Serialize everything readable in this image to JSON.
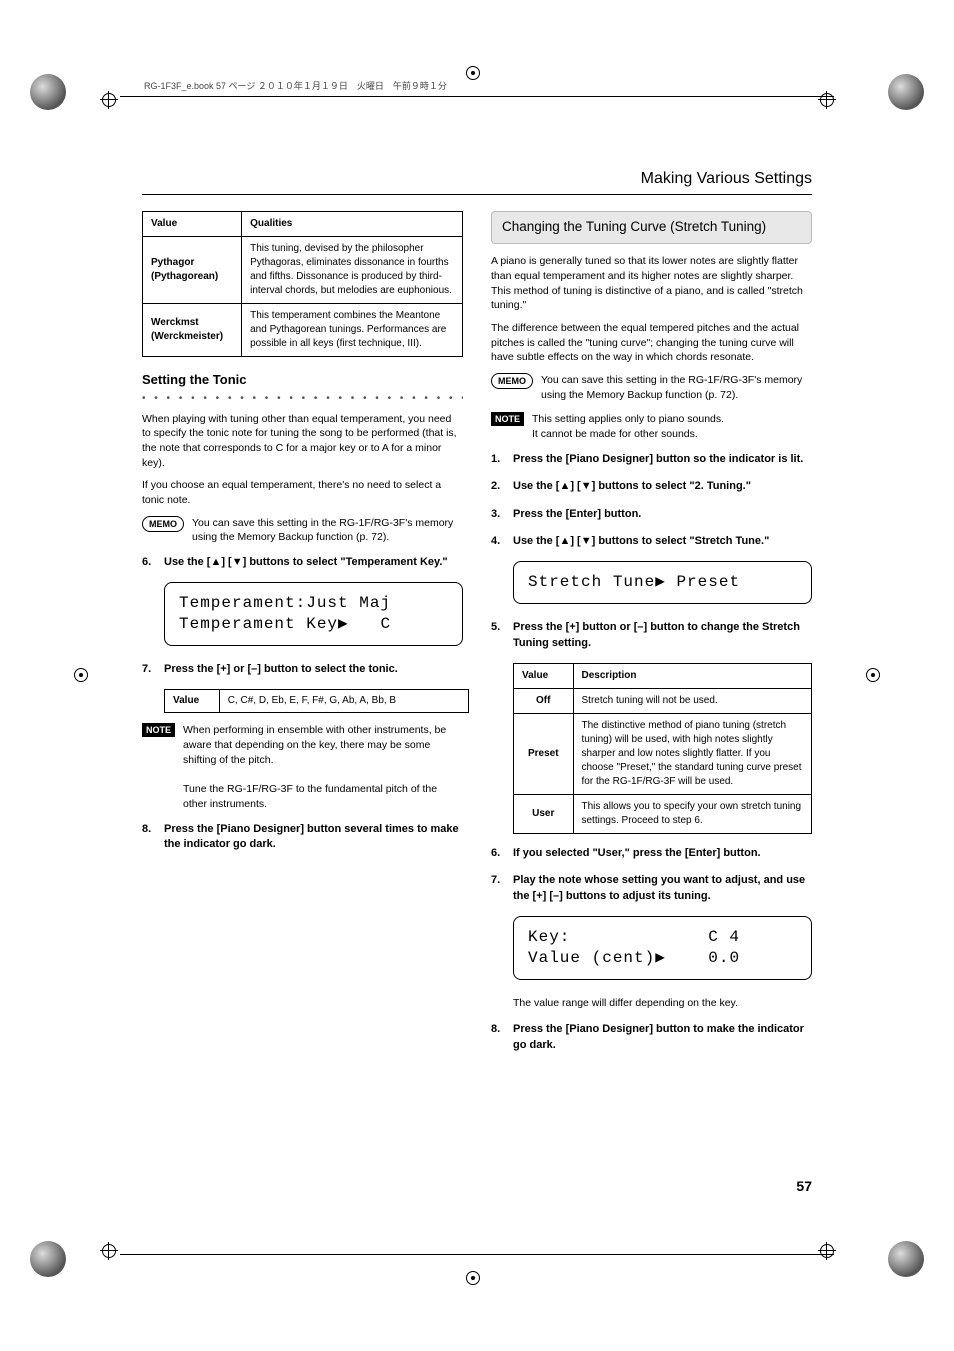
{
  "printHeader": "RG-1F3F_e.book  57 ページ  ２０１０年１月１９日　火曜日　午前９時１分",
  "headerTitle": "Making Various Settings",
  "tuningTable": {
    "headers": [
      "Value",
      "Qualities"
    ],
    "rows": [
      {
        "value": "Pythagor (Pythagorean)",
        "qual": "This tuning, devised by the philosopher Pythagoras, eliminates dissonance in fourths and fifths. Dissonance is produced by third-interval chords, but melodies are euphonious."
      },
      {
        "value": "Werckmst (Werckmeister)",
        "qual": "This temperament combines the Meantone and Pythagorean tunings. Performances are possible in all keys (first technique, III)."
      }
    ]
  },
  "settingTonic": {
    "heading": "Setting the Tonic",
    "dots": "• • • • • • • • • • • • • • • • • • • • • • • • • • • • • • • • • • • • • • •",
    "p1": "When playing with tuning other than equal temperament, you need to specify the tonic note for tuning the song to be performed (that is, the note that corresponds to C for a major key or to A for a minor key).",
    "p2": "If you choose an equal temperament, there's no need to select a tonic note.",
    "memo": "You can save this setting in the RG-1F/RG-3F's memory using the Memory Backup function (p. 72).",
    "step6": "Use the [▲] [▼] buttons to select \"Temperament Key.\"",
    "lcd1a": "Temperament:Just Maj",
    "lcd1b": "Temperament Key▶   C",
    "step7": "Press the [+] or [–] button to select the tonic.",
    "valueLabel": "Value",
    "valueList": "C, C#, D, Eb, E, F, F#, G, Ab, A, Bb, B",
    "note1": "When performing in ensemble with other instruments, be aware that depending on the key, there may be some shifting of the pitch.",
    "note2": "Tune the RG-1F/RG-3F to the fundamental pitch of the other instruments.",
    "step8": "Press the [Piano Designer] button several times to make the indicator go dark."
  },
  "stretch": {
    "section": "Changing the Tuning Curve (Stretch Tuning)",
    "p1": "A piano is generally tuned so that its lower notes are slightly flatter than equal temperament and its higher notes are slightly sharper. This method of tuning is distinctive of a piano, and is called \"stretch tuning.\"",
    "p2": "The difference between the equal tempered pitches and the actual pitches is called the \"tuning curve\"; changing the tuning curve will have subtle effects on the way in which chords resonate.",
    "memo": "You can save this setting in the RG-1F/RG-3F's memory using the Memory Backup function (p. 72).",
    "noteA": "This setting applies only to piano sounds.",
    "noteB": "It cannot be made for other sounds.",
    "step1": "Press the [Piano Designer] button so the indicator is lit.",
    "step2": "Use the [▲] [▼] buttons to select \"2. Tuning.\"",
    "step3": "Press the [Enter] button.",
    "step4": "Use the [▲] [▼] buttons to select \"Stretch Tune.\"",
    "lcd": "Stretch Tune▶ Preset",
    "step5": "Press the [+] button or [–] button to change the Stretch Tuning setting.",
    "tableHeaders": [
      "Value",
      "Description"
    ],
    "tableRows": [
      {
        "v": "Off",
        "d": "Stretch tuning will not be used."
      },
      {
        "v": "Preset",
        "d": "The distinctive method of piano tuning (stretch tuning) will be used, with high notes slightly sharper and low notes slightly flatter. If you choose \"Preset,\" the standard tuning curve preset for the RG-1F/RG-3F will be used."
      },
      {
        "v": "User",
        "d": "This allows you to specify your own stretch tuning settings. Proceed to step 6."
      }
    ],
    "step6": "If you selected \"User,\" press the [Enter] button.",
    "step7": "Play the note whose setting you want to adjust, and use the [+] [–] buttons to adjust its tuning.",
    "lcd2a": "Key:             C 4",
    "lcd2b": "Value (cent)▶    0.0",
    "hint": "The value range will differ depending on the key.",
    "step8": "Press the [Piano Designer] button to make the indicator go dark."
  },
  "labels": {
    "memo": "MEMO",
    "note": "NOTE"
  },
  "pageNum": "57"
}
